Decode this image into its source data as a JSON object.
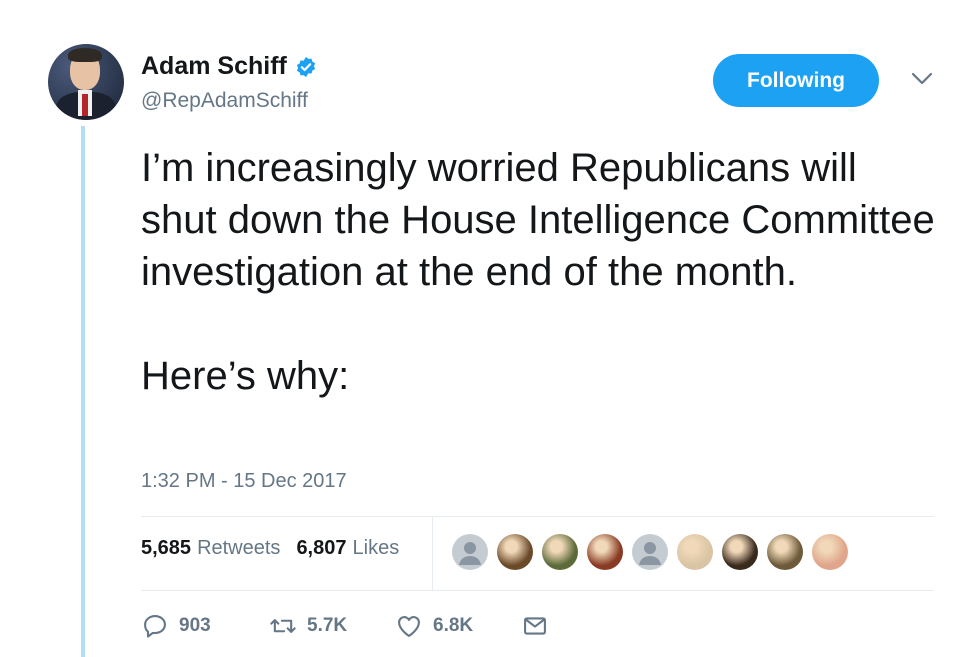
{
  "user": {
    "display_name": "Adam Schiff",
    "handle": "@RepAdamSchiff",
    "verified": true
  },
  "follow_button": {
    "label": "Following"
  },
  "tweet": {
    "paragraphs": [
      "I’m increasingly worried Republicans will shut down the House Intelligence Committee investigation at the end of the month.",
      "Here’s why:"
    ],
    "timestamp": "1:32 PM - 15 Dec 2017"
  },
  "stats": {
    "retweets_count": "5,685",
    "retweets_label": "Retweets",
    "likes_count": "6,807",
    "likes_label": "Likes"
  },
  "likers": [
    {
      "color": "#c4cbd1",
      "icon": "default-profile-icon"
    },
    {
      "color": "#6b4a2a",
      "icon": "liker-avatar"
    },
    {
      "color": "#5d6b3a",
      "icon": "liker-avatar"
    },
    {
      "color": "#8a3b24",
      "icon": "liker-avatar"
    },
    {
      "color": "#c4cbd1",
      "icon": "default-profile-icon"
    },
    {
      "color": "#d9c4a4",
      "icon": "liker-avatar"
    },
    {
      "color": "#3a2a1e",
      "icon": "liker-avatar"
    },
    {
      "color": "#6d5a3a",
      "icon": "liker-avatar"
    },
    {
      "color": "#e0a58a",
      "icon": "liker-avatar"
    }
  ],
  "actions": {
    "reply_count": "903",
    "retweet_count": "5.7K",
    "like_count": "6.8K"
  },
  "colors": {
    "accent": "#1da1f2",
    "secondary_text": "#657786",
    "thread_line": "#b3dcf7"
  }
}
